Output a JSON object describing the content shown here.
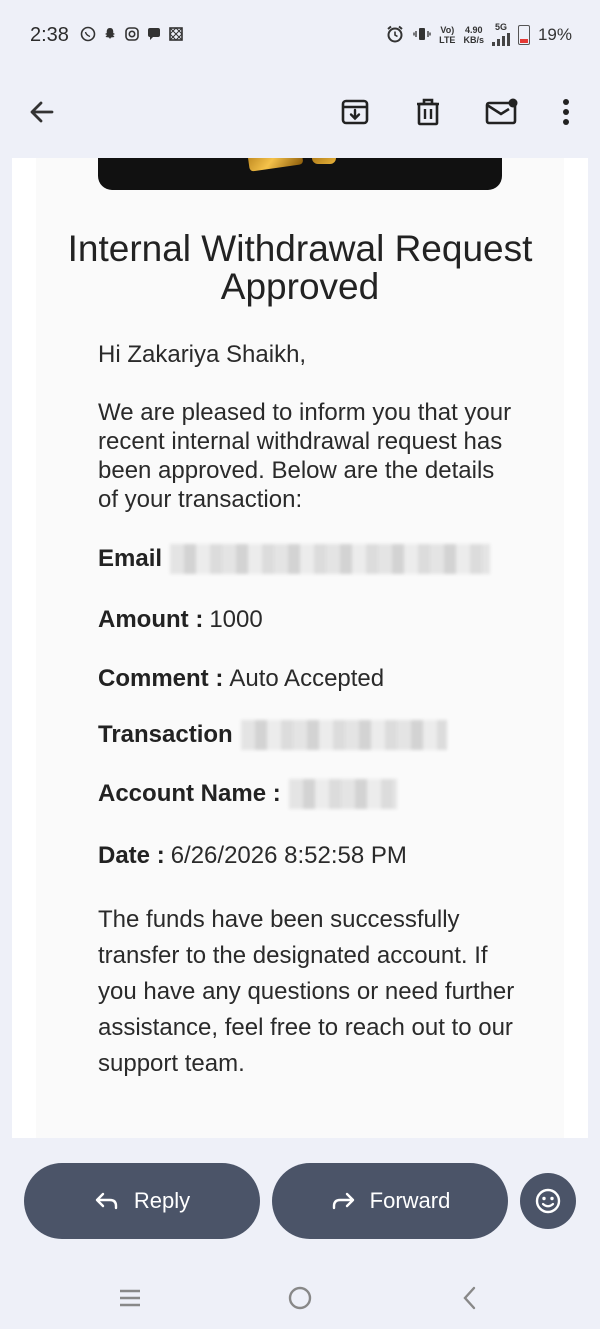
{
  "status": {
    "time": "2:38",
    "network_top": "Vo)",
    "network_bottom": "LTE",
    "speed_top": "4.90",
    "speed_bottom": "KB/s",
    "net_type": "5G",
    "battery": "19%"
  },
  "email": {
    "title": "Internal Withdrawal Request Approved",
    "greeting": "Hi Zakariya Shaikh,",
    "intro": "We are pleased to inform you that your recent internal withdrawal request has been approved. Below are the details of your transaction:",
    "fields": {
      "email_label": "Email",
      "amount_label": "Amount :",
      "amount_value": "1000",
      "comment_label": "Comment :",
      "comment_value": "Auto Accepted",
      "transaction_label": "Transaction",
      "account_label": "Account Name :",
      "date_label": "Date :",
      "date_value": "6/26/2026 8:52:58 PM"
    },
    "closing": "The funds have been successfully transfer to the designated account. If you have any questions or need further assistance, feel free to reach out to our support team."
  },
  "actions": {
    "reply_label": "Reply",
    "forward_label": "Forward"
  },
  "icons": {
    "back": "arrow-left",
    "archive": "archive-download",
    "delete": "trash",
    "mark_unread": "mail-unread",
    "more": "more-vertical",
    "emoji": "smiley"
  },
  "colors": {
    "button_bg": "#4b5468",
    "background": "#eef0f8",
    "battery_low": "#e53935"
  }
}
